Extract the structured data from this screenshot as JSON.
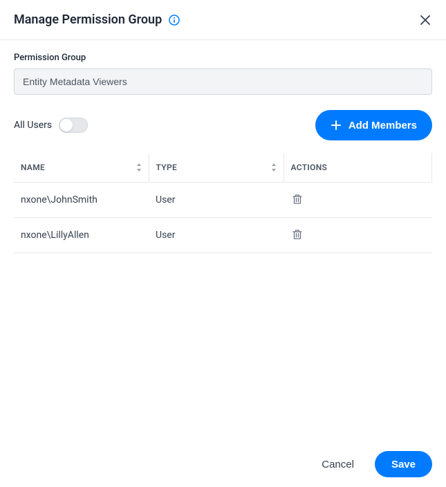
{
  "header": {
    "title": "Manage Permission Group"
  },
  "form": {
    "group_label": "Permission Group",
    "group_value": "Entity Metadata Viewers",
    "all_users_label": "All Users",
    "all_users_on": false
  },
  "buttons": {
    "add_members": "Add Members",
    "cancel": "Cancel",
    "save": "Save"
  },
  "table": {
    "headers": {
      "name": "NAME",
      "type": "TYPE",
      "actions": "ACTIONS"
    },
    "rows": [
      {
        "name": "nxone\\JohnSmith",
        "type": "User"
      },
      {
        "name": "nxone\\LillyAllen",
        "type": "User"
      }
    ]
  }
}
